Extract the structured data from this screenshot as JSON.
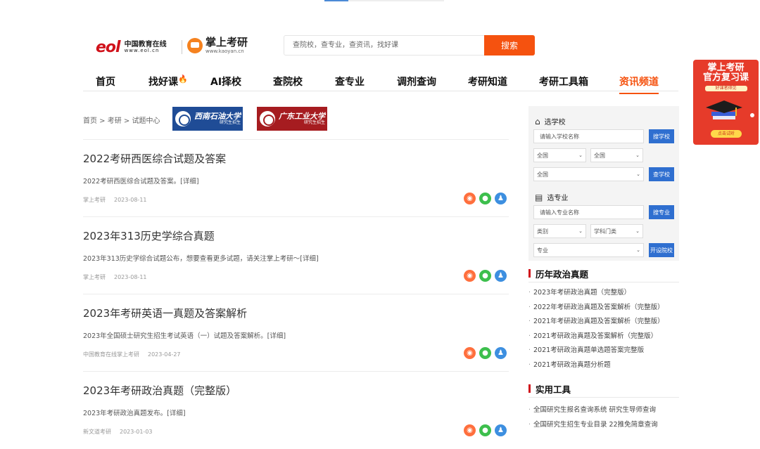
{
  "header": {
    "logo_eol": "eol",
    "logo_eol_cn": "中国教育在线",
    "logo_eol_url": "www.eol.cn",
    "logo_ky": "掌上考研",
    "logo_ky_url": "www.kaoyan.cn",
    "search_placeholder": "查院校，查专业，查资讯，找好课",
    "search_button": "搜索"
  },
  "nav": {
    "items": [
      "首页",
      "找好课",
      "AI择校",
      "查院校",
      "查专业",
      "调剂查询",
      "考研知道",
      "考研工具箱",
      "资讯频道"
    ],
    "active": "资讯频道"
  },
  "breadcrumb": "首页 > 考研 > 试题中心",
  "banners": [
    {
      "name": "西南石油大学",
      "sub": "研究生招生"
    },
    {
      "name": "广东工业大学",
      "sub": "研究生招生"
    }
  ],
  "articles": [
    {
      "title": "2022考研西医综合试题及答案",
      "summary": "2022考研西医综合试题及答案。[详细]",
      "source": "掌上考研",
      "date": "2023-08-11"
    },
    {
      "title": "2023年313历史学综合真题",
      "summary": "2023年313历史学综合试题公布，想要查看更多试题，请关注掌上考研～[详细]",
      "source": "掌上考研",
      "date": "2023-08-11"
    },
    {
      "title": "2023年考研英语一真题及答案解析",
      "summary": "2023年全国硕士研究生招生考试英语（一）试题及答案解析。[详细]",
      "source": "中国教育在线掌上考研",
      "date": "2023-04-27"
    },
    {
      "title": "2023年考研政治真题（完整版）",
      "summary": "2023年考研政治真题发布。[详细]",
      "source": "新文道考研",
      "date": "2023-01-03"
    }
  ],
  "panel": {
    "school_title": "选学校",
    "school_placeholder": "请输入学校名称",
    "school_button": "搜学校",
    "region1": "全国",
    "region2": "全国",
    "region3": "全国",
    "check_school_button": "查学校",
    "major_title": "选专业",
    "major_placeholder": "请输入专业名称",
    "major_button": "搜专业",
    "category": "类别",
    "discipline": "学科门类",
    "major_select": "专业",
    "open_button": "开设院校"
  },
  "politics": {
    "title": "历年政治真题",
    "items": [
      "2023年考研政治真题（完整版）",
      "2022年考研政治真题及答案解析（完整版）",
      "2021年考研政治真题及答案解析（完整版）",
      "2021考研政治真题及答案解析（完整版）",
      "2021考研政治真题单选题答案完整版",
      "2021考研政治真题分析题"
    ]
  },
  "tools": {
    "title": "实用工具",
    "items": [
      "全国研究生报名查询系统 研究生导师查询",
      "全国研究生招生专业目录 22推免简章查询"
    ]
  },
  "promo": {
    "line1": "掌上考研",
    "line2": "官方复习课",
    "sub": "好课者得见",
    "cta": "点击试听"
  }
}
